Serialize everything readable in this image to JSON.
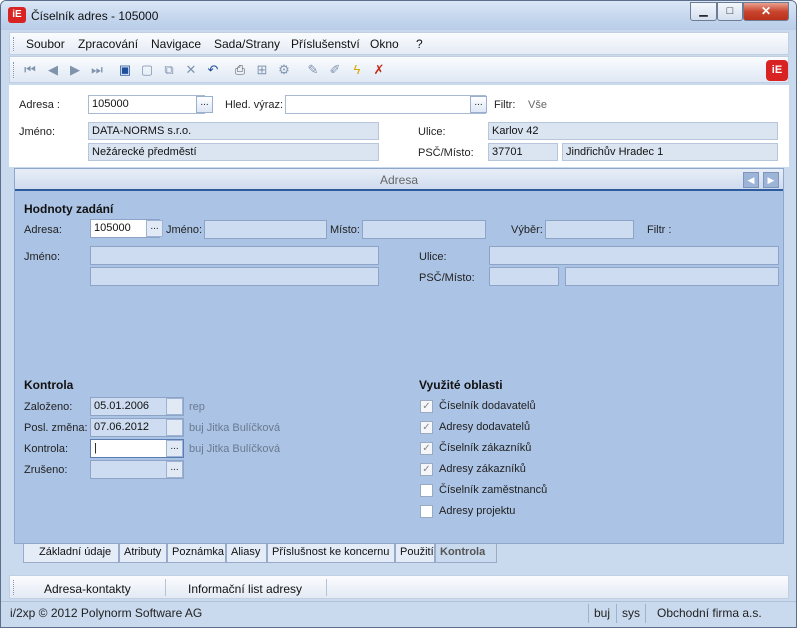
{
  "window": {
    "title": "Číselník adres - 105000",
    "app_icon": "iE",
    "controls": {
      "minimize": "▁",
      "maximize": "□",
      "close": "✕"
    }
  },
  "menu": {
    "items": [
      "Soubor",
      "Zpracování",
      "Navigace",
      "Sada/Strany",
      "Příslušenství",
      "Okno",
      "?"
    ]
  },
  "toolbar": {
    "logo": "iE"
  },
  "header": {
    "adresa_label": "Adresa :",
    "adresa_value": "105000",
    "hled_label": "Hled. výraz:",
    "hled_value": "",
    "filtr_label": "Filtr:",
    "filtr_value": "Vše",
    "jmeno_label": "Jméno:",
    "jmeno_line1": "DATA-NORMS s.r.o.",
    "jmeno_line2": "Nežárecké předměstí",
    "ulice_label": "Ulice:",
    "ulice_value": "Karlov 42",
    "psc_label": "PSČ/Místo:",
    "psc_value": "37701",
    "misto_value": "Jindřichův Hradec 1",
    "dots": "..."
  },
  "panel": {
    "title": "Adresa",
    "hodnoty_title": "Hodnoty zadání",
    "adresa_label": "Adresa:",
    "adresa_value": "105000",
    "jmeno_inline_label": "Jméno:",
    "misto_label": "Místo:",
    "vyber_label": "Výběr:",
    "filtr_label": "Filtr :",
    "jmeno_label": "Jméno:",
    "ulice_label": "Ulice:",
    "psc_label": "PSČ/Místo:",
    "kontrola_title": "Kontrola",
    "zalozeno_label": "Založeno:",
    "zalozeno_value": "05.01.2006",
    "zalozeno_user": "rep",
    "posl_label": "Posl. změna:",
    "posl_value": "07.06.2012",
    "posl_user": "buj  Jitka Bulíčková",
    "kontrola_label": "Kontrola:",
    "kontrola_user": "buj  Jitka Bulíčková",
    "zruseno_label": "Zrušeno:",
    "oblasti_title": "Využité oblasti",
    "oblasti": [
      {
        "label": "Číselník dodavatelů",
        "checked": true
      },
      {
        "label": "Adresy dodavatelů",
        "checked": true
      },
      {
        "label": "Číselník zákazníků",
        "checked": true
      },
      {
        "label": "Adresy zákazníků",
        "checked": true
      },
      {
        "label": "Číselník zaměstnanců",
        "checked": false
      },
      {
        "label": "Adresy projektu",
        "checked": false
      }
    ]
  },
  "tabs": [
    "Základní údaje",
    "Atributy",
    "Poznámka",
    "Aliasy",
    "Příslušnost ke koncernu",
    "Použití",
    "Kontrola"
  ],
  "bottom": {
    "item1": "Adresa-kontakty",
    "item2": "Informační list adresy"
  },
  "status": {
    "copyright": "i/2xp © 2012 Polynorm Software AG",
    "user": "buj",
    "db": "sys",
    "company": "Obchodní firma a.s."
  },
  "colors": {
    "accent": "#2e5b9d",
    "panel_bg": "#abc3e4",
    "window_bg": "#c9d9ee",
    "logo_red": "#d92323"
  }
}
